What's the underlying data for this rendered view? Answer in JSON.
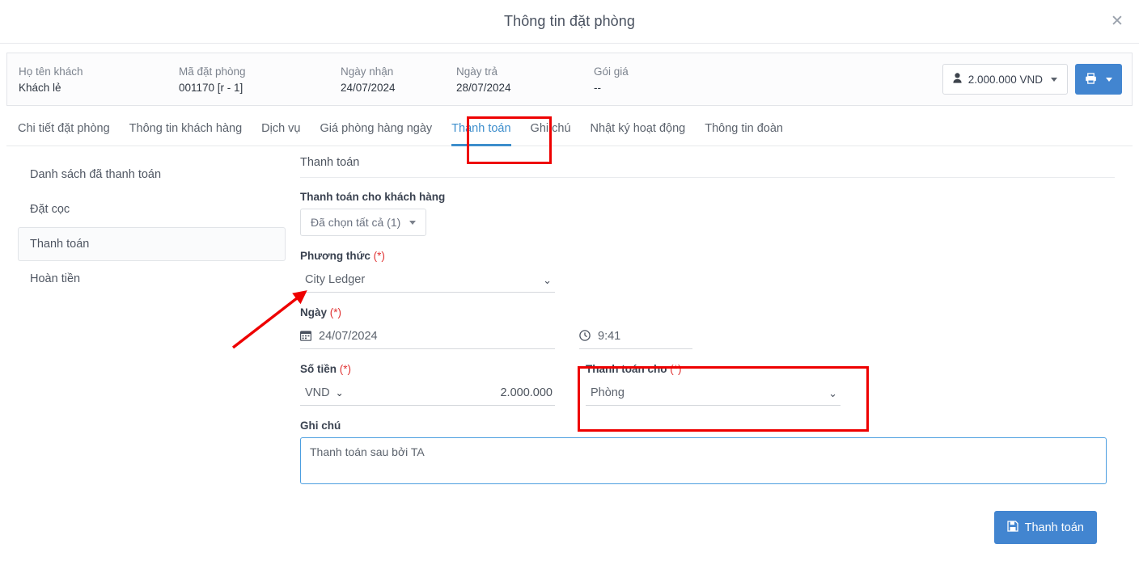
{
  "modal": {
    "title": "Thông tin đặt phòng",
    "close_icon": "close-icon",
    "close_glyph": "✕"
  },
  "booking_info": {
    "fields": [
      {
        "label": "Họ tên khách",
        "value": "Khách lẻ"
      },
      {
        "label": "Mã đặt phòng",
        "value": "001170 [r - 1]"
      },
      {
        "label": "Ngày nhận",
        "value": "24/07/2024"
      },
      {
        "label": "Ngày trả",
        "value": "28/07/2024"
      },
      {
        "label": "Gói giá",
        "value": "--"
      }
    ],
    "amount_button": {
      "icon": "person-icon",
      "glyph": "👤",
      "label": "2.000.000 VND"
    },
    "print_button": {
      "icon": "printer-icon",
      "glyph": "🖶"
    }
  },
  "tabs": [
    {
      "label": "Chi tiết đặt phòng",
      "active": false
    },
    {
      "label": "Thông tin khách hàng",
      "active": false
    },
    {
      "label": "Dịch vụ",
      "active": false
    },
    {
      "label": "Giá phòng hàng ngày",
      "active": false
    },
    {
      "label": "Thanh toán",
      "active": true
    },
    {
      "label": "Ghi chú",
      "active": false
    },
    {
      "label": "Nhật ký hoạt động",
      "active": false
    },
    {
      "label": "Thông tin đoàn",
      "active": false
    }
  ],
  "side_nav": [
    {
      "label": "Danh sách đã thanh toán",
      "active": false
    },
    {
      "label": "Đặt cọc",
      "active": false
    },
    {
      "label": "Thanh toán",
      "active": true
    },
    {
      "label": "Hoàn tiền",
      "active": false
    }
  ],
  "form": {
    "section_title": "Thanh toán",
    "customer": {
      "label": "Thanh toán cho khách hàng",
      "selected": "Đã chọn tất cả (1)"
    },
    "method": {
      "label": "Phương thức",
      "required_mark": "(*)",
      "value": "City Ledger",
      "chevron": "⌄"
    },
    "date": {
      "label": "Ngày",
      "required_mark": "(*)",
      "value": "24/07/2024",
      "icon": "calendar-icon",
      "glyph": "▦"
    },
    "time": {
      "value": "9:41",
      "icon": "clock-icon",
      "glyph": "◔"
    },
    "amount": {
      "label": "Số tiền",
      "required_mark": "(*)",
      "currency": "VND",
      "value": "2.000.000",
      "chevron": "⌄"
    },
    "pay_for": {
      "label": "Thanh toán cho",
      "required_mark": "(*)",
      "value": "Phòng",
      "chevron": "⌄"
    },
    "note": {
      "label": "Ghi chú",
      "value": "Thanh toán sau bởi TA",
      "placeholder": "Ghi chú"
    },
    "submit": {
      "label": "Thanh toán",
      "icon": "save-icon",
      "glyph": "💾"
    }
  },
  "annotations": {
    "accent_color": "#ee0000",
    "boxes": [
      {
        "name": "tab-thanh-toan-highlight"
      },
      {
        "name": "thanh-toan-cho-highlight"
      }
    ],
    "arrow": {
      "name": "method-field-arrow"
    }
  },
  "colors": {
    "primary_blue": "#4285d0",
    "tab_active_blue": "#3d8ecc",
    "annotation_red": "#ee0000",
    "required_red": "#e03131"
  }
}
